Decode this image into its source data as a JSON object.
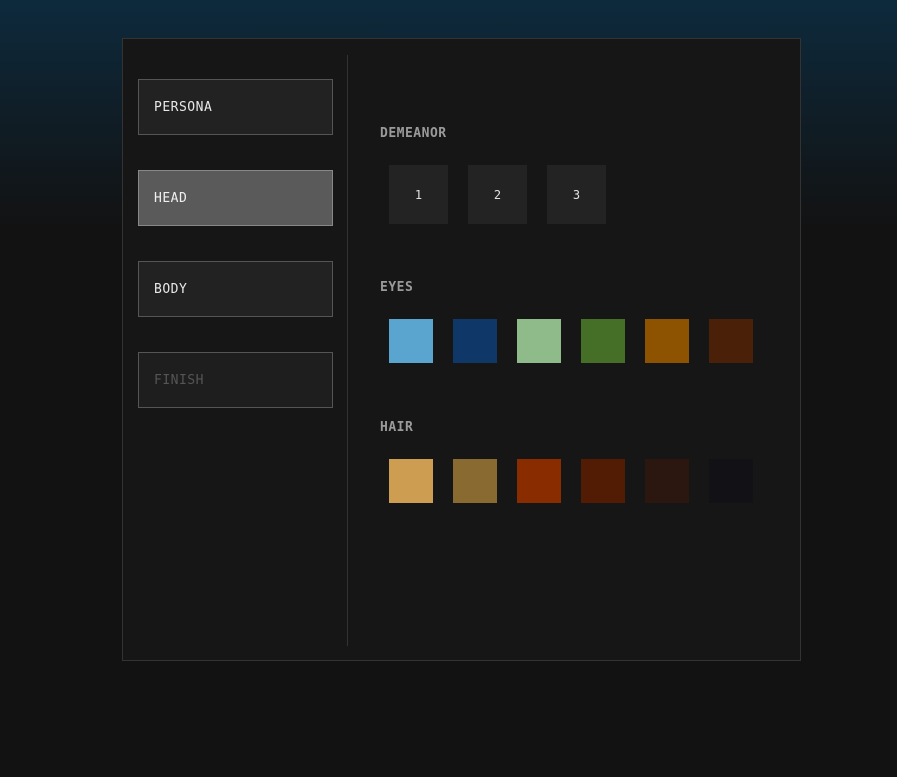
{
  "nav": {
    "items": [
      {
        "label": "PERSONA",
        "state": "default"
      },
      {
        "label": "HEAD",
        "state": "active"
      },
      {
        "label": "BODY",
        "state": "default"
      },
      {
        "label": "FINISH",
        "state": "disabled"
      }
    ]
  },
  "demeanor": {
    "title": "DEMEANOR",
    "options": [
      "1",
      "2",
      "3"
    ]
  },
  "eyes": {
    "title": "EYES",
    "colors": [
      "#5aa5d0",
      "#0f3868",
      "#8fbb8a",
      "#456e27",
      "#8e5300",
      "#4a2008"
    ]
  },
  "hair": {
    "title": "HAIR",
    "colors": [
      "#cd9d52",
      "#896a30",
      "#892d00",
      "#521c04",
      "#2b1610",
      "#111116"
    ]
  }
}
